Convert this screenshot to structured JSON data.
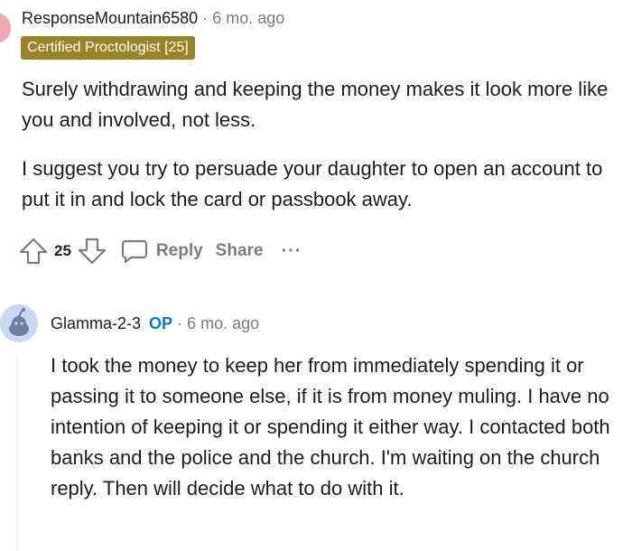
{
  "comment1": {
    "username": "ResponseMountain6580",
    "separator": "·",
    "time": "6 mo. ago",
    "flair": "Certified Proctologist [25]",
    "paragraphs": [
      "Surely withdrawing and keeping the money makes it look more like you and involved, not less.",
      "I suggest you try to persuade your daughter to open an account to put it in and lock the card or passbook away."
    ],
    "actions": {
      "vote_count": "25",
      "reply_label": "Reply",
      "share_label": "Share",
      "more_label": "···"
    }
  },
  "comment2": {
    "username": "Glamma-2-3",
    "op_badge": "OP",
    "separator": "·",
    "time": "6 mo. ago",
    "paragraphs": [
      "I took the money to keep her from immediately spending it or passing it to someone else, if it is from money muling. I have no intention of keeping it or spending it either way. I contacted both banks and the police and the church. I'm waiting on the church reply. Then will decide what to do with it."
    ]
  },
  "colors": {
    "flair_bg": "#9a8226",
    "op_blue": "#0079d3",
    "meta_gray": "#7c7c7c",
    "avatar1": "#f3a7ae",
    "avatar2": "#c9d9f5"
  },
  "icons": [
    "upvote-icon",
    "downvote-icon",
    "comment-bubble-icon",
    "more-options-icon",
    "snoo-avatar-icon"
  ]
}
